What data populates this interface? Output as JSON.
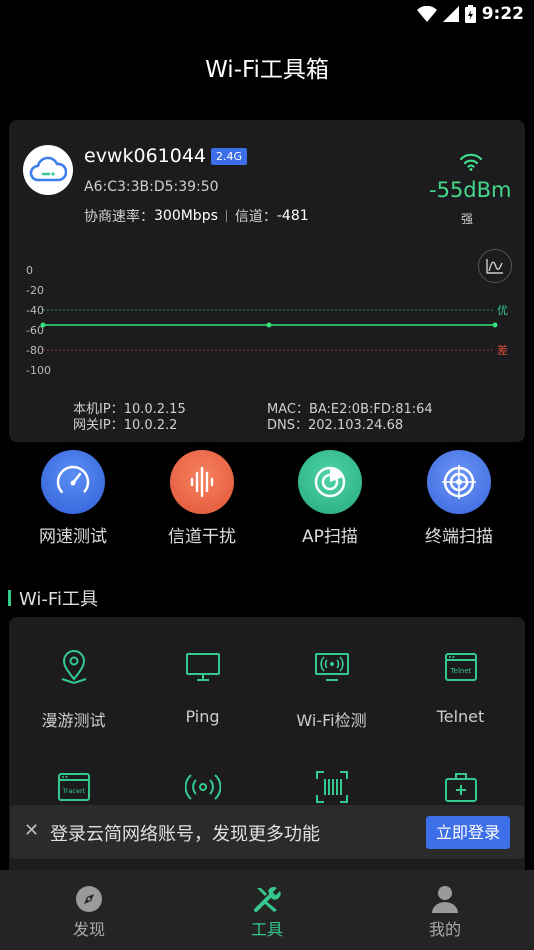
{
  "status_bar": {
    "time": "9:22"
  },
  "header": {
    "title": "Wi-Fi工具箱"
  },
  "wifi": {
    "ssid": "evwk061044",
    "band": "2.4G",
    "bssid": "A6:C3:3B:D5:39:50",
    "rate_label": "协商速率：",
    "rate_value": "300Mbps",
    "channel_label": "信道：",
    "channel_value": "-481",
    "signal": "-55dBm",
    "signal_quality": "强",
    "local_ip_label": "本机IP：",
    "local_ip": "10.0.2.15",
    "gateway_ip_label": "网关IP：",
    "gateway_ip": "10.0.2.2",
    "mac_label": "MAC：",
    "mac": "BA:E2:0B:FD:81:64",
    "dns_label": "DNS：",
    "dns": "202.103.24.68"
  },
  "chart_data": {
    "type": "line",
    "y_ticks": [
      "0",
      "-20",
      "-40",
      "-60",
      "-80",
      "-100"
    ],
    "ylim": [
      -100,
      0
    ],
    "thresholds": [
      {
        "value": -40,
        "label": "优",
        "color": "#35c98e"
      },
      {
        "value": -80,
        "label": "差",
        "color": "#e04a3a"
      }
    ],
    "series": [
      {
        "values": [
          -55,
          -55,
          -55
        ],
        "color": "#35e07a"
      }
    ]
  },
  "quick_tools": [
    {
      "label": "网速测试",
      "icon": "speedometer-icon"
    },
    {
      "label": "信道干扰",
      "icon": "waveform-icon"
    },
    {
      "label": "AP扫描",
      "icon": "radar-icon"
    },
    {
      "label": "终端扫描",
      "icon": "target-icon"
    }
  ],
  "section": {
    "title": "Wi-Fi工具"
  },
  "tools": [
    {
      "label": "漫游测试",
      "icon": "location-pin-icon"
    },
    {
      "label": "Ping",
      "icon": "monitor-icon"
    },
    {
      "label": "Wi-Fi检测",
      "icon": "wifi-detect-icon"
    },
    {
      "label": "Telnet",
      "icon": "telnet-window-icon",
      "icon_text": "Telnet"
    },
    {
      "label": "Tracert",
      "icon": "tracert-window-icon",
      "icon_text": "Tracert"
    },
    {
      "label": "",
      "icon": "broadcast-icon"
    },
    {
      "label": "",
      "icon": "barcode-scan-icon"
    },
    {
      "label": "",
      "icon": "toolbox-icon"
    }
  ],
  "login_banner": {
    "text": "登录云简网络账号，发现更多功能",
    "button": "立即登录"
  },
  "nav": [
    {
      "label": "发现",
      "icon": "compass-icon",
      "active": false
    },
    {
      "label": "工具",
      "icon": "tools-icon",
      "active": true
    },
    {
      "label": "我的",
      "icon": "user-icon",
      "active": false
    }
  ],
  "colors": {
    "accent_green": "#35c98e",
    "signal_green": "#44d98a",
    "brand_blue": "#3d6fe8",
    "card_bg": "#1c1c1e"
  }
}
